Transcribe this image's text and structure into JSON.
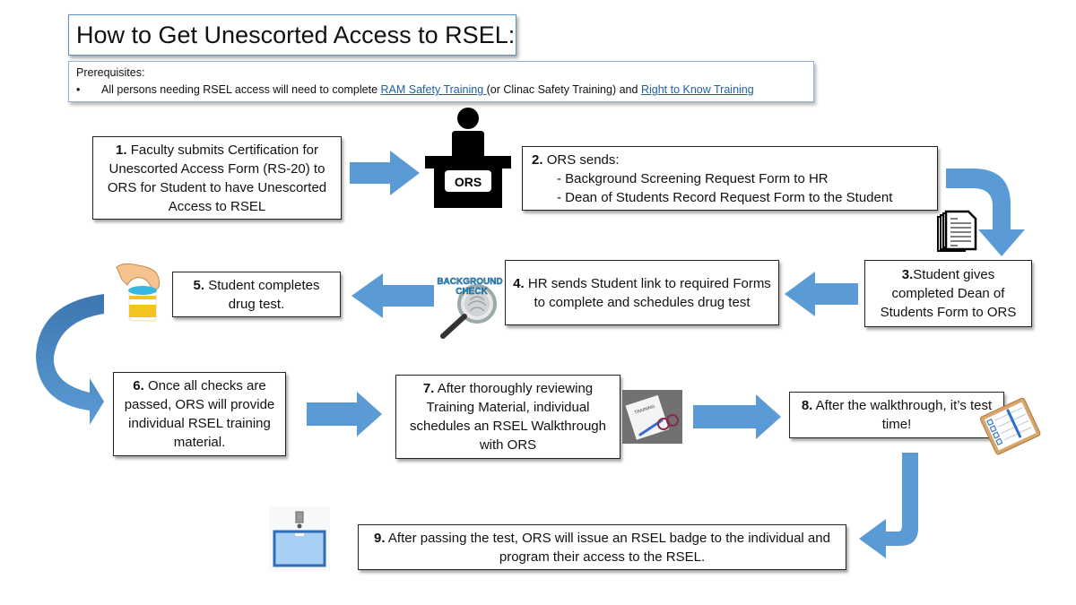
{
  "title": "How to Get Unescorted Access to RSEL:",
  "prerequisites": {
    "heading": "Prerequisites:",
    "bullet": "•",
    "text_before": "All persons needing RSEL access will need to complete ",
    "link1": "RAM Safety Training ",
    "text_middle": "(or Clinac Safety Training) and ",
    "link2": "Right to Know Training"
  },
  "steps": [
    {
      "num": "1.",
      "text": "Faculty submits Certification for Unescorted Access Form (RS-20) to ORS for Student to have Unescorted Access to RSEL"
    },
    {
      "num": "2.",
      "text": "ORS sends:",
      "items": [
        "- Background Screening Request Form to HR",
        "- Dean of Students Record Request Form to the Student"
      ]
    },
    {
      "num": "3.",
      "text": "Student gives completed Dean of Students Form to ORS"
    },
    {
      "num": "4.",
      "text": "HR sends Student link to required Forms to complete and schedules drug test"
    },
    {
      "num": "5.",
      "text": "Student completes drug test."
    },
    {
      "num": "6.",
      "text": "Once all checks are passed, ORS will provide individual RSEL training material."
    },
    {
      "num": "7.",
      "text": "After thoroughly reviewing Training Material, individual schedules an RSEL Walkthrough with ORS"
    },
    {
      "num": "8.",
      "text": "After the walkthrough, it’s test time!"
    },
    {
      "num": "9.",
      "text": "After passing the test, ORS will issue an RSEL badge to the individual and program their access to the RSEL."
    }
  ],
  "icons": {
    "ors_desk_label": "ORS",
    "background_check_label1": "BACKGROUND",
    "background_check_label2": "CHECK",
    "training_label": "TRAINING"
  },
  "colors": {
    "arrow": "#5b9bd5",
    "arrow_dark": "#3d76b0",
    "link": "#1f5fa6",
    "title_border": "#5b8fc7"
  }
}
